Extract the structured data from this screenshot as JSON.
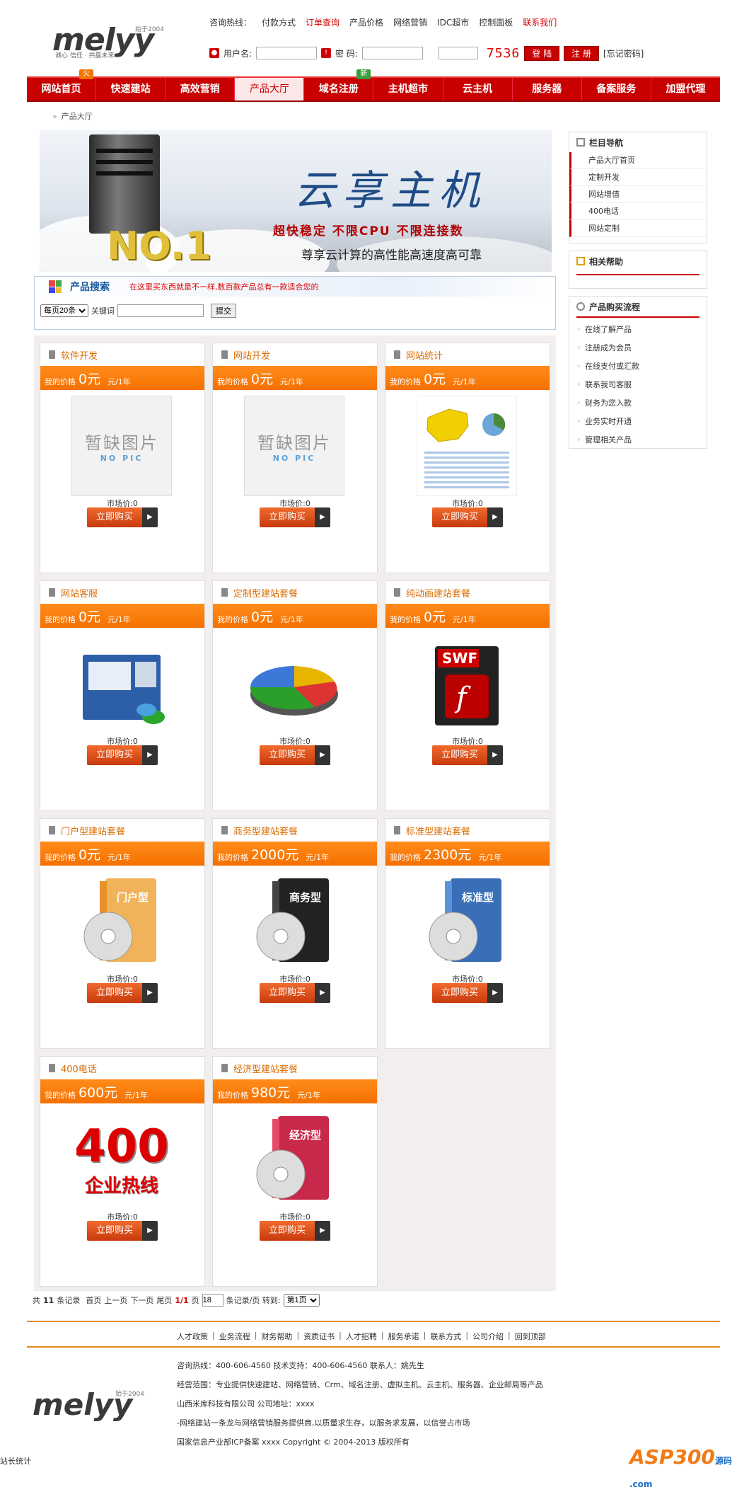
{
  "header": {
    "logo_text": "melyy",
    "logo_tag": "始于2004",
    "logo_slogan": "诚心 信任 · 共赢未来",
    "hotline_label": "咨询热线：",
    "hot_links": [
      {
        "label": "付款方式",
        "red": false
      },
      {
        "label": "订单查询",
        "red": true
      },
      {
        "label": "产品价格",
        "red": false
      },
      {
        "label": "网络营销",
        "red": false
      },
      {
        "label": "IDC超市",
        "red": false
      },
      {
        "label": "控制面板",
        "red": false
      },
      {
        "label": "联系我们",
        "red": true
      }
    ],
    "username_label": "用户名:",
    "password_label": "密 码:",
    "captcha": "7536",
    "login_button": "登 陆",
    "register_button": "注 册",
    "forgot_link": "[忘记密码]"
  },
  "nav": {
    "items": [
      {
        "label": "网站首页",
        "badge": "火",
        "badge_type": "hot"
      },
      {
        "label": "快速建站"
      },
      {
        "label": "高效营销"
      },
      {
        "label": "产品大厅",
        "active": true
      },
      {
        "label": "域名注册",
        "badge": "新",
        "badge_type": "new"
      },
      {
        "label": "主机超市"
      },
      {
        "label": "云主机"
      },
      {
        "label": "服务器"
      },
      {
        "label": "备案服务"
      },
      {
        "label": "加盟代理"
      }
    ]
  },
  "breadcrumb": "产品大厅",
  "banner": {
    "no1": "NO.1",
    "title": "云享主机",
    "slogan": "超快稳定   不限CPU   不限连接数",
    "sub": "尊享云计算的高性能高速度高可靠"
  },
  "search": {
    "title": "产品搜索",
    "tip": "在这里买东西就是不一样,数百款产品总有一款适合您的",
    "per_page": "每页20条",
    "keyword_label": "关键词",
    "submit": "提交"
  },
  "products": [
    {
      "name": "软件开发",
      "price_label": "我的价格",
      "price": "0元",
      "unit": "元/1年",
      "market": "市场价:0",
      "buy": "立即购买",
      "pic": "nopic"
    },
    {
      "name": "网站开发",
      "price_label": "我的价格",
      "price": "0元",
      "unit": "元/1年",
      "market": "市场价:0",
      "buy": "立即购买",
      "pic": "nopic"
    },
    {
      "name": "网站统计",
      "price_label": "我的价格",
      "price": "0元",
      "unit": "元/1年",
      "market": "市场价:0",
      "buy": "立即购买",
      "pic": "stats"
    },
    {
      "name": "网站客服",
      "price_label": "我的价格",
      "price": "0元",
      "unit": "元/1年",
      "market": "市场价:0",
      "buy": "立即购买",
      "pic": "chat"
    },
    {
      "name": "定制型建站套餐",
      "price_label": "我的价格",
      "price": "0元",
      "unit": "元/1年",
      "market": "市场价:0",
      "buy": "立即购买",
      "pic": "pie"
    },
    {
      "name": "纯动画建站套餐",
      "price_label": "我的价格",
      "price": "0元",
      "unit": "元/1年",
      "market": "市场价:0",
      "buy": "立即购买",
      "pic": "swf"
    },
    {
      "name": "门户型建站套餐",
      "price_label": "我的价格",
      "price": "0元",
      "unit": "元/1年",
      "market": "市场价:0",
      "buy": "立即购买",
      "pic": "box-portal",
      "box_label": "门户型"
    },
    {
      "name": "商务型建站套餐",
      "price_label": "我的价格",
      "price": "2000元",
      "unit": "元/1年",
      "market": "市场价:0",
      "buy": "立即购买",
      "pic": "box-business",
      "box_label": "商务型"
    },
    {
      "name": "标准型建站套餐",
      "price_label": "我的价格",
      "price": "2300元",
      "unit": "元/1年",
      "market": "市场价:0",
      "buy": "立即购买",
      "pic": "box-standard",
      "box_label": "标准型"
    },
    {
      "name": "400电话",
      "price_label": "我的价格",
      "price": "600元",
      "unit": "元/1年",
      "market": "市场价:0",
      "buy": "立即购买",
      "pic": "phone400",
      "big": "400",
      "big_sub": "企业热线"
    },
    {
      "name": "经济型建站套餐",
      "price_label": "我的价格",
      "price": "980元",
      "unit": "元/1年",
      "market": "市场价:0",
      "buy": "立即购买",
      "pic": "box-economy",
      "box_label": "经济型"
    }
  ],
  "nopic": {
    "cn": "暂缺图片",
    "en": "NO PIC"
  },
  "pager": {
    "total_prefix": "共",
    "total": "11",
    "total_suffix": "条记录",
    "first": "首页",
    "prev": "上一页",
    "next": "下一页",
    "last": "尾页",
    "page": "1/1",
    "page_suffix": "页",
    "per_page": "18",
    "per_page_suffix": "条记录/页 转到:",
    "goto": "第1页"
  },
  "sidebar": {
    "nav_title": "栏目导航",
    "nav_items": [
      "产品大厅首页",
      "定制开发",
      "网站增值",
      "400电话",
      "网站定制"
    ],
    "help_title": "相关帮助",
    "flow_title": "产品购买流程",
    "flow_items": [
      "在线了解产品",
      "注册成为会员",
      "在线支付或汇款",
      "联系我司客服",
      "财务为您入款",
      "业务实时开通",
      "管理相关产品"
    ]
  },
  "footer": {
    "links": [
      "人才政策",
      "业务流程",
      "财务帮助",
      "资质证书",
      "人才招聘",
      "服务承诺",
      "联系方式",
      "公司介绍",
      "回到顶部"
    ],
    "lines": [
      "咨询热线：400-606-4560   技术支持：400-606-4560   联系人：姚先生",
      "经营范围：专业提供快速建站、网络营销、Crm、域名注册、虚拟主机、云主机、服务器、企业邮局等产品",
      "山西米库科技有限公司   公司地址：xxxx",
      "-网络建站一条龙与网络营销服务提供商,以质量求生存，以服务求发展，以信誉占市场",
      "国家信息产业部ICP备案   xxxx   Copyright © 2004-2013      版权所有"
    ],
    "stat": "站长统计",
    "watermark": "ASP300",
    "watermark_sub": "源码\n.com"
  }
}
